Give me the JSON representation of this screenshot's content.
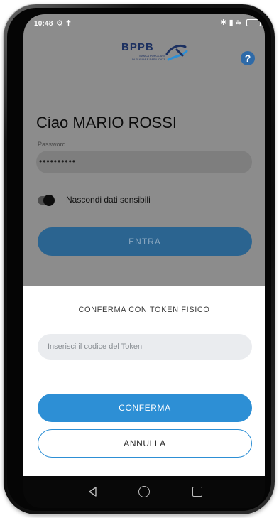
{
  "status_bar": {
    "time": "10:48",
    "left_icons": "⚙ ✝",
    "right_icons": "✱ ▮ ≋"
  },
  "logo": {
    "text": "BPPB",
    "subtitle_line1": "BANCA POPOLARE",
    "subtitle_line2": "DI PUGLIA E BASILICATA"
  },
  "help": {
    "label": "?"
  },
  "login": {
    "greeting": "Ciao MARIO ROSSI",
    "password_label": "Password",
    "password_value": "••••••••••",
    "toggle_label": "Nascondi dati sensibili",
    "enter_button": "ENTRA"
  },
  "token_sheet": {
    "title": "CONFERMA CON TOKEN FISICO",
    "input_placeholder": "Inserisci il codice del Token",
    "confirm_button": "CONFERMA",
    "cancel_button": "ANNULLA"
  },
  "colors": {
    "primary_blue": "#2d8fd5",
    "brand_navy": "#1c3060",
    "overlay_gray": "#8c8c8c"
  }
}
